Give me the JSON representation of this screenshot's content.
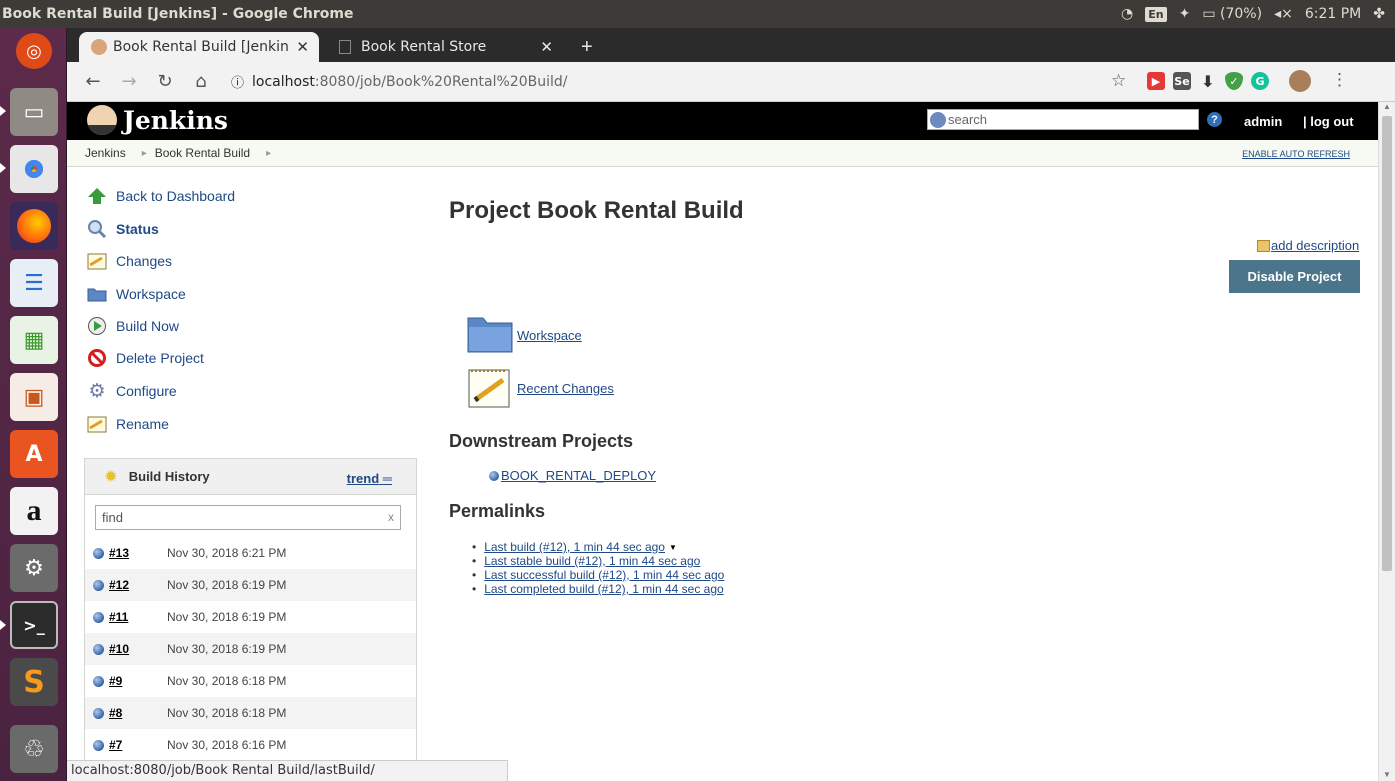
{
  "os": {
    "window_title": "Book Rental Build [Jenkins] - Google Chrome",
    "lang": "En",
    "battery": "(70%)",
    "time": "6:21 PM"
  },
  "launcher": {
    "items": [
      "ubuntu-dash-icon",
      "files-icon",
      "chrome-icon",
      "firefox-icon",
      "writer-icon",
      "calc-icon",
      "impress-icon",
      "software-center-icon",
      "amazon-icon",
      "system-settings-icon",
      "terminal-icon",
      "sublime-text-icon",
      "trash-icon"
    ]
  },
  "browser": {
    "tabs": [
      {
        "label": "Book Rental Build [Jenkin",
        "active": true
      },
      {
        "label": "Book Rental Store",
        "active": false
      }
    ],
    "url_host": "localhost",
    "url_path": ":8080/job/Book%20Rental%20Build/",
    "status_bar": "localhost:8080/job/Book Rental Build/lastBuild/"
  },
  "jenkins": {
    "logo_text": "Jenkins",
    "search_placeholder": "search",
    "user": "admin",
    "logout": "| log out",
    "breadcrumbs": [
      "Jenkins",
      "Book Rental Build"
    ],
    "auto_refresh": "ENABLE AUTO REFRESH"
  },
  "sidepanel": {
    "tasks": [
      {
        "label": "Back to Dashboard",
        "icon": "up-arrow-icon"
      },
      {
        "label": "Status",
        "icon": "magnifier-icon"
      },
      {
        "label": "Changes",
        "icon": "notepad-icon"
      },
      {
        "label": "Workspace",
        "icon": "folder-icon"
      },
      {
        "label": "Build Now",
        "icon": "clock-play-icon"
      },
      {
        "label": "Delete Project",
        "icon": "no-entry-icon"
      },
      {
        "label": "Configure",
        "icon": "gear-icon"
      },
      {
        "label": "Rename",
        "icon": "notepad-icon"
      }
    ],
    "build_history": {
      "title": "Build History",
      "trend": "trend",
      "find_placeholder": "find",
      "find_clear": "x",
      "builds": [
        {
          "num": "#13",
          "date": "Nov 30, 2018 6:21 PM"
        },
        {
          "num": "#12",
          "date": "Nov 30, 2018 6:19 PM"
        },
        {
          "num": "#11",
          "date": "Nov 30, 2018 6:19 PM"
        },
        {
          "num": "#10",
          "date": "Nov 30, 2018 6:19 PM"
        },
        {
          "num": "#9",
          "date": "Nov 30, 2018 6:18 PM"
        },
        {
          "num": "#8",
          "date": "Nov 30, 2018 6:18 PM"
        },
        {
          "num": "#7",
          "date": "Nov 30, 2018 6:16 PM"
        }
      ]
    }
  },
  "main": {
    "title": "Project Book Rental Build",
    "add_description": "add description",
    "disable_button": "Disable Project",
    "workspace_link": "Workspace",
    "recent_changes_link": "Recent Changes",
    "downstream_heading": "Downstream Projects",
    "downstream_project": "BOOK_RENTAL_DEPLOY",
    "permalinks_heading": "Permalinks",
    "permalinks": [
      "Last build (#12), 1 min 44 sec ago",
      "Last stable build (#12), 1 min 44 sec ago",
      "Last successful build (#12), 1 min 44 sec ago",
      "Last completed build (#12), 1 min 44 sec ago"
    ]
  }
}
